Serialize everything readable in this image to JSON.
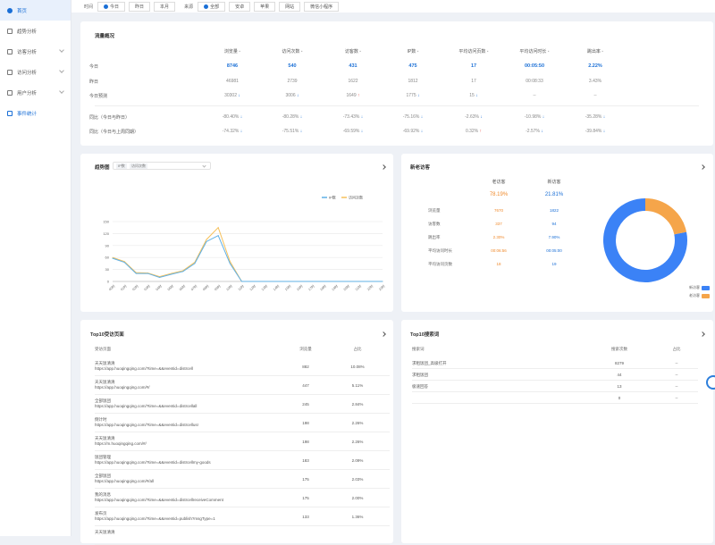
{
  "sidebar": {
    "items": [
      {
        "label": "首页",
        "icon": "home-icon",
        "active": true,
        "home": true,
        "chevron": false
      },
      {
        "label": "趋势分析",
        "icon": "trend-icon",
        "chevron": false
      },
      {
        "label": "访客分析",
        "icon": "visitor-icon",
        "chevron": true
      },
      {
        "label": "访问分析",
        "icon": "access-icon",
        "chevron": true
      },
      {
        "label": "用户分析",
        "icon": "user-icon",
        "chevron": true
      },
      {
        "label": "事件统计",
        "icon": "event-icon",
        "active": true,
        "chevron": false
      }
    ]
  },
  "topbar": {
    "time_label": "时间",
    "time_options": [
      "今日",
      "昨日",
      "本月"
    ],
    "source_label": "来源",
    "source_options": [
      "全部",
      "安卓",
      "苹果",
      "网站",
      "微信小程序"
    ]
  },
  "overview": {
    "title": "流量概况",
    "columns": [
      "浏览量",
      "访问次数",
      "访客数",
      "IP数",
      "平均访问页数",
      "平均访问时长",
      "跳出率"
    ],
    "rows": [
      {
        "label": "今日",
        "style": "blue",
        "values": [
          "8746",
          "540",
          "431",
          "475",
          "17",
          "00:05:50",
          "2.22%"
        ],
        "arrows": [
          "",
          "",
          "",
          "",
          "",
          "",
          ""
        ]
      },
      {
        "label": "昨日",
        "style": "gray",
        "values": [
          "46981",
          "2739",
          "1622",
          "1812",
          "17",
          "00:08:33",
          "3.43%"
        ],
        "arrows": [
          "",
          "",
          "",
          "",
          "",
          "",
          ""
        ]
      },
      {
        "label": "今日预测",
        "style": "gray",
        "values": [
          "30302",
          "3006",
          "1649",
          "1775",
          "15",
          "--",
          "--"
        ],
        "arrows": [
          "down",
          "down",
          "up",
          "down",
          "down",
          "",
          ""
        ]
      },
      {
        "label": "同比（今日与昨日）",
        "style": "gray",
        "values": [
          "-80.40%",
          "-80.28%",
          "-73.43%",
          "-75.16%",
          "-2.63%",
          "-10.98%",
          "-35.28%"
        ],
        "arrows": [
          "down",
          "down",
          "down",
          "down",
          "down",
          "down",
          "down"
        ]
      },
      {
        "label": "同比（今日与上周同期）",
        "style": "gray",
        "values": [
          "-74.32%",
          "-75.51%",
          "-69.59%",
          "-69.92%",
          "0.32%",
          "-2.57%",
          "-39.84%"
        ],
        "arrows": [
          "down",
          "down",
          "down",
          "down",
          "up",
          "down",
          "down"
        ]
      }
    ]
  },
  "trend": {
    "title": "趋势图",
    "select_tags": [
      "IP数",
      "访问次数"
    ],
    "legend": [
      "IP数",
      "访问次数"
    ]
  },
  "chart_data": {
    "type": "line",
    "x": [
      "00时",
      "01时",
      "02时",
      "03时",
      "04时",
      "05时",
      "06时",
      "07时",
      "08时",
      "09时",
      "10时",
      "11时",
      "12时",
      "13时",
      "14时",
      "15时",
      "16时",
      "17时",
      "18时",
      "19时",
      "20时",
      "21时",
      "22时",
      "23时"
    ],
    "series": [
      {
        "name": "IP数",
        "color": "#5fb0e6",
        "values": [
          58,
          48,
          20,
          20,
          10,
          18,
          25,
          45,
          100,
          115,
          45,
          0,
          0,
          0,
          0,
          0,
          0,
          0,
          0,
          0,
          0,
          0,
          0,
          0
        ]
      },
      {
        "name": "访问次数",
        "color": "#f5c05a",
        "values": [
          60,
          50,
          22,
          21,
          12,
          20,
          27,
          48,
          105,
          135,
          50,
          0,
          0,
          0,
          0,
          0,
          0,
          0,
          0,
          0,
          0,
          0,
          0,
          0
        ]
      }
    ],
    "yticks": [
      0,
      30,
      60,
      90,
      120,
      150
    ],
    "ylim": [
      0,
      150
    ],
    "grid": true,
    "legend_position": "top-right"
  },
  "newold": {
    "title": "新老访客",
    "old_label": "老访客",
    "new_label": "新访客",
    "old_pct": "78.19%",
    "new_pct": "21.81%",
    "rows": [
      {
        "label": "浏览量",
        "old": "7670",
        "new": "1822"
      },
      {
        "label": "访客数",
        "old": "337",
        "new": "94"
      },
      {
        "label": "跳出率",
        "old": "2.30%",
        "new": "7.90%"
      },
      {
        "label": "平均访问时长",
        "old": "00:06:56",
        "new": "00:05:00"
      },
      {
        "label": "平均访问页数",
        "old": "18",
        "new": "19"
      }
    ],
    "donut": {
      "old_fraction": 0.7819,
      "new_fraction": 0.2181,
      "old_color": "#3b82f6",
      "new_color": "#f5a54a"
    },
    "legend": [
      "新访客",
      "老访客"
    ]
  },
  "top_pages": {
    "title": "Top10受访页面",
    "headers": [
      "受访页面",
      "浏览量",
      "占比"
    ],
    "rows": [
      {
        "name": "天天饭清清",
        "url": "https://app.huoqingqing.com/?time=&&eventid=distrcell",
        "views": "882",
        "pct": "10.08%"
      },
      {
        "name": "天天饭清清",
        "url": "https://app.huoqingqing.com/#/",
        "views": "447",
        "pct": "5.11%"
      },
      {
        "name": "全部饭团",
        "url": "https://app.huoqingqing.com/?time=&&eventid=distrcellall",
        "views": "245",
        "pct": "2.84%"
      },
      {
        "name": "倒计时",
        "url": "https://app.huoqingqing.com/?time=&&eventid=distrcellusr",
        "views": "198",
        "pct": "2.26%"
      },
      {
        "name": "天天饭清清",
        "url": "https://m.huoqingqing.com/#/",
        "views": "198",
        "pct": "2.26%"
      },
      {
        "name": "饭团管理",
        "url": "https://app.huoqingqing.com/?time=&&eventid=distrcellmy-goods",
        "views": "183",
        "pct": "2.09%"
      },
      {
        "name": "全部饭团",
        "url": "https://app.huoqingqing.com/#/all",
        "views": "175",
        "pct": "2.03%"
      },
      {
        "name": "我的消息",
        "url": "https://app.huoqingqing.com/?time=&&eventid=distrcellreceiveComment",
        "views": "175",
        "pct": "2.00%"
      },
      {
        "name": "发布页",
        "url": "https://app.huoqingqing.com/?time=&&eventid=publish?msgType=1",
        "views": "133",
        "pct": "1.36%"
      },
      {
        "name": "天天饭清清",
        "url": "",
        "views": "",
        "pct": ""
      }
    ]
  },
  "top_keywords": {
    "title": "Top10搜索词",
    "headers": [
      "搜索词",
      "搜索次数",
      "占比"
    ],
    "rows": [
      {
        "word": "求租饭团_高级打开",
        "count": "8279",
        "pct": "--"
      },
      {
        "word": "求租饭团",
        "count": "44",
        "pct": "--"
      },
      {
        "word": "极速回答",
        "count": "13",
        "pct": "--"
      },
      {
        "word": "",
        "count": "0",
        "pct": "--"
      }
    ]
  }
}
